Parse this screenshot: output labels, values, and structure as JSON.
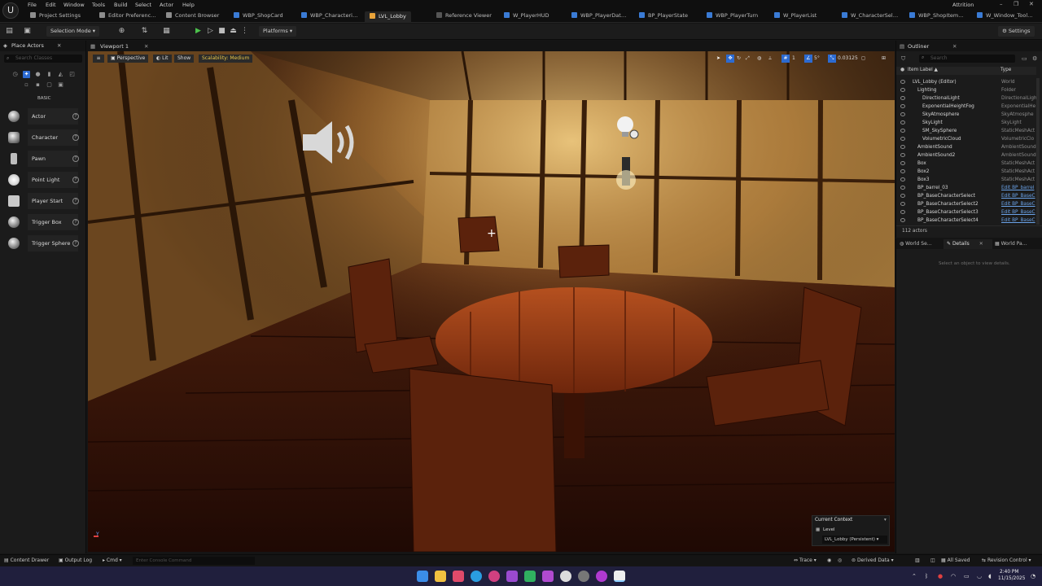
{
  "menubar": {
    "items": [
      "File",
      "Edit",
      "Window",
      "Tools",
      "Build",
      "Select",
      "Actor",
      "Help"
    ],
    "project_name": "Attrition",
    "window_controls": [
      "–",
      "❐",
      "✕"
    ]
  },
  "tabs": {
    "items": [
      {
        "label": "Project Settings",
        "color": "#9a9a9a"
      },
      {
        "label": "Editor Preferenc…",
        "color": "#9a9a9a"
      },
      {
        "label": "Content Browser",
        "color": "#9a9a9a"
      },
      {
        "label": "WBP_ShopCard",
        "color": "#3a7bd5"
      },
      {
        "label": "WBP_Characteri…",
        "color": "#3a7bd5"
      },
      {
        "label": "LVL_Lobby",
        "color": "#e8a33a"
      },
      {
        "label": "Reference Viewer",
        "color": "#9a9a9a"
      },
      {
        "label": "W_PlayerHUD",
        "color": "#3a7bd5"
      },
      {
        "label": "WBP_PlayerDat…",
        "color": "#3a7bd5"
      },
      {
        "label": "BP_PlayerState",
        "color": "#3a7bd5"
      },
      {
        "label": "WBP_PlayerTurn",
        "color": "#3a7bd5"
      },
      {
        "label": "W_PlayerList",
        "color": "#3a7bd5"
      },
      {
        "label": "W_CharacterSel…",
        "color": "#3a7bd5"
      },
      {
        "label": "WBP_ShopItem…",
        "color": "#3a7bd5"
      },
      {
        "label": "W_Window_Tool…",
        "color": "#3a7bd5"
      }
    ]
  },
  "toolbar": {
    "selection_mode": "Selection Mode",
    "platforms": "Platforms",
    "settings": "Settings"
  },
  "place_actors": {
    "title": "Place Actors",
    "search_placeholder": "Search Classes",
    "category": "BASIC",
    "actors": [
      "Actor",
      "Character",
      "Pawn",
      "Point Light",
      "Player Start",
      "Trigger Box",
      "Trigger Sphere"
    ]
  },
  "viewport": {
    "tab": "Viewport 1",
    "perspective": "Perspective",
    "lit": "Lit",
    "show": "Show",
    "scalability": "Scalability: Medium",
    "camera_speed": "0.03125",
    "grid_value": "1",
    "angle_value": "5°",
    "axis_label": "Y"
  },
  "current_context": {
    "title": "Current Context",
    "level_label": "Level",
    "level_value": "LVL_Lobby (Persistent)"
  },
  "outliner": {
    "title": "Outliner",
    "search_placeholder": "Search",
    "col_label": "Item Label ▲",
    "col_type": "Type",
    "rows": [
      {
        "name": "LVL_Lobby (Editor)",
        "type": "World",
        "indent": 1,
        "link": false
      },
      {
        "name": "Lighting",
        "type": "Folder",
        "indent": 2,
        "link": false
      },
      {
        "name": "DirectionalLight",
        "type": "DirectionalLight",
        "indent": 3,
        "link": false
      },
      {
        "name": "ExponentialHeightFog",
        "type": "ExponentialHe",
        "indent": 3,
        "link": false
      },
      {
        "name": "SkyAtmosphere",
        "type": "SkyAtmosphe",
        "indent": 3,
        "link": false
      },
      {
        "name": "SkyLight",
        "type": "SkyLight",
        "indent": 3,
        "link": false
      },
      {
        "name": "SM_SkySphere",
        "type": "StaticMeshAct",
        "indent": 3,
        "link": false
      },
      {
        "name": "VolumetricCloud",
        "type": "VolumetricClo",
        "indent": 3,
        "link": false
      },
      {
        "name": "AmbientSound",
        "type": "AmbientSound",
        "indent": 2,
        "link": false
      },
      {
        "name": "AmbientSound2",
        "type": "AmbientSound",
        "indent": 2,
        "link": false
      },
      {
        "name": "Box",
        "type": "StaticMeshAct",
        "indent": 2,
        "link": false
      },
      {
        "name": "Box2",
        "type": "StaticMeshAct",
        "indent": 2,
        "link": false
      },
      {
        "name": "Box3",
        "type": "StaticMeshAct",
        "indent": 2,
        "link": false
      },
      {
        "name": "BP_barrel_03",
        "type": "Edit BP_barrel",
        "indent": 2,
        "link": true
      },
      {
        "name": "BP_BaseCharacterSelect",
        "type": "Edit BP_BaseC",
        "indent": 2,
        "link": true
      },
      {
        "name": "BP_BaseCharacterSelect2",
        "type": "Edit BP_BaseC",
        "indent": 2,
        "link": true
      },
      {
        "name": "BP_BaseCharacterSelect3",
        "type": "Edit BP_BaseC",
        "indent": 2,
        "link": true
      },
      {
        "name": "BP_BaseCharacterSelect4",
        "type": "Edit BP_BaseC",
        "indent": 2,
        "link": true
      }
    ],
    "actor_count": "112 actors"
  },
  "details": {
    "tabs": [
      "World Se…",
      "Details",
      "World Pa…"
    ],
    "empty_text": "Select an object to view details."
  },
  "statusbar": {
    "content_drawer": "Content Drawer",
    "output_log": "Output Log",
    "cmd": "Cmd",
    "console_placeholder": "Enter Console Command",
    "trace": "Trace",
    "derived_data": "Derived Data",
    "all_saved": "All Saved",
    "revision_control": "Revision Control"
  },
  "taskbar": {
    "time": "2:40 PM",
    "date": "11/15/2025"
  }
}
